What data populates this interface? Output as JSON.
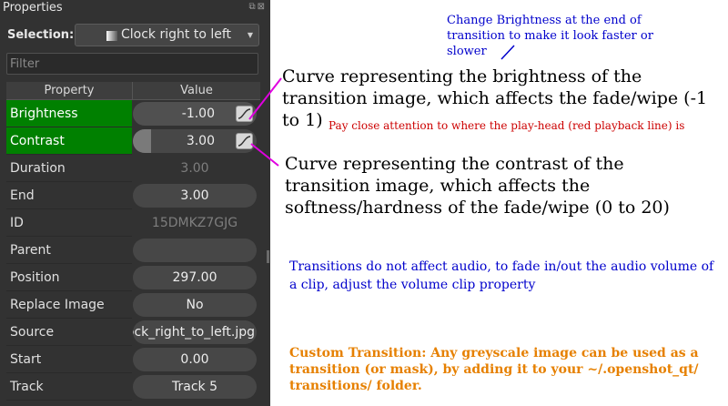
{
  "panel": {
    "title": "Properties",
    "selection_label": "Selection:",
    "selection_value": "Clock right to left",
    "filter_placeholder": "Filter"
  },
  "table": {
    "headers": [
      "Property",
      "Value"
    ],
    "rows": [
      {
        "name": "Brightness",
        "value": "-1.00",
        "highlighted": true,
        "curve": true
      },
      {
        "name": "Contrast",
        "value": "3.00",
        "highlighted": true,
        "curve": true,
        "slider_fraction": 0.15
      },
      {
        "name": "Duration",
        "value": "3.00",
        "readonly": true
      },
      {
        "name": "End",
        "value": "3.00"
      },
      {
        "name": "ID",
        "value": "15DMKZ7GJG",
        "readonly": true
      },
      {
        "name": "Parent",
        "value": ""
      },
      {
        "name": "Position",
        "value": "297.00"
      },
      {
        "name": "Replace Image",
        "value": "No"
      },
      {
        "name": "Source",
        "value": "clock_right_to_left.jpg"
      },
      {
        "name": "Start",
        "value": "0.00"
      },
      {
        "name": "Track",
        "value": "Track 5"
      }
    ]
  },
  "annotations": {
    "brightness_timing": "Change Brightness at the end of transition to make it look faster or slower",
    "brightness_curve": "Curve representing the brightness of the transition image, which affects the fade/wipe (-1 to 1)",
    "playhead": "Pay close attention to where the play-head (red playback line) is",
    "contrast_curve": "Curve representing the contrast of the transition image, which affects the softness/hardness of the fade/wipe (0 to 20)",
    "audio": "Transitions do not affect audio, to fade in/out the audio volume of a clip, adjust the volume clip property",
    "custom": "Custom Transition: Any greyscale image can be used as a transition (or mask), by adding it to your ~/.openshot_qt/ transitions/ folder."
  },
  "colors": {
    "highlight": "#008000",
    "arrow": "#e000e0",
    "blue_note": "#0000cc",
    "red_note": "#cc0000",
    "orange_note": "#e68000"
  }
}
